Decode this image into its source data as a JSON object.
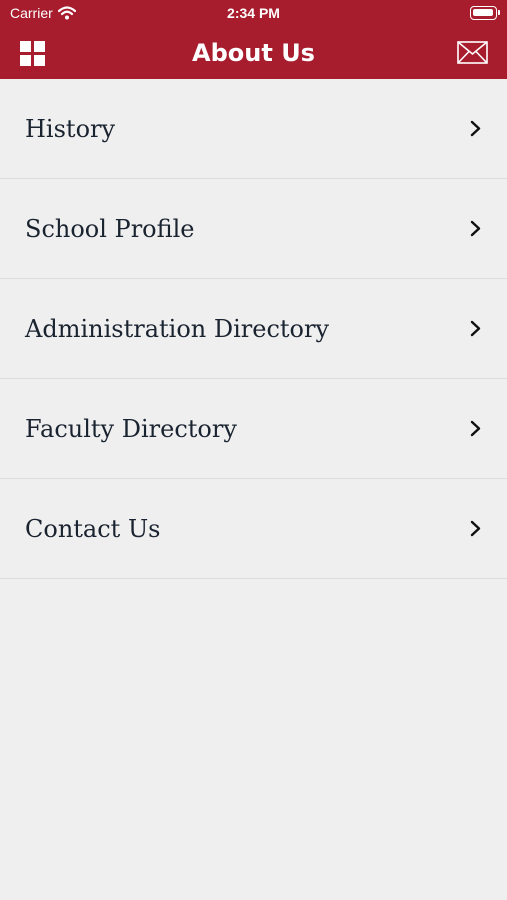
{
  "status_bar": {
    "carrier": "Carrier",
    "time": "2:34 PM"
  },
  "header": {
    "title": "About Us",
    "background_color": "#a71d2d",
    "left_icon": "grid-menu-icon",
    "right_icon": "mail-icon"
  },
  "menu": {
    "items": [
      {
        "label": "History"
      },
      {
        "label": "School Profile"
      },
      {
        "label": "Administration Directory"
      },
      {
        "label": "Faculty Directory"
      },
      {
        "label": "Contact Us"
      }
    ]
  }
}
